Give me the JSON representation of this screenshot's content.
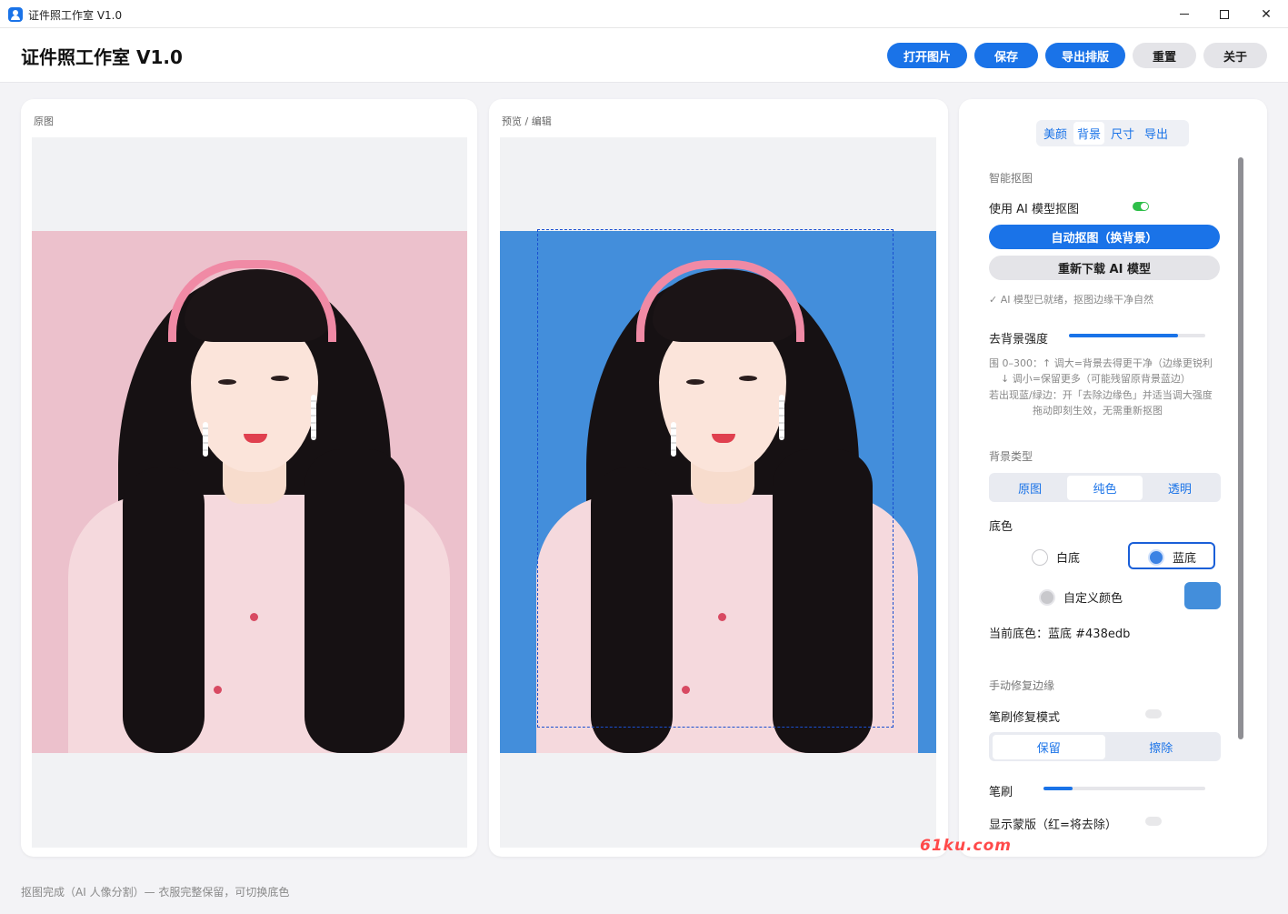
{
  "window": {
    "title": "证件照工作室 V1.0",
    "controls": {
      "minimize": "—",
      "maximize": "☐",
      "close": "✕"
    }
  },
  "header": {
    "title": "证件照工作室 V1.0",
    "buttons": {
      "open": "打开图片",
      "save": "保存",
      "export_layout": "导出排版",
      "reset": "重置",
      "about": "关于"
    }
  },
  "left_panel": {
    "label": "原图"
  },
  "middle_panel": {
    "label": "预览 / 编辑"
  },
  "right_panel": {
    "tabs": [
      "美颜",
      "背景",
      "尺寸",
      "导出"
    ],
    "active_tab": "背景",
    "smart_cutout": {
      "section_title": "智能抠图",
      "use_ai_label": "使用 AI 模型抠图",
      "use_ai_on": true,
      "auto_button": "自动抠图（换背景）",
      "redownload_button": "重新下载 AI 模型",
      "status": "✓ AI 模型已就绪，抠图边缘干净自然"
    },
    "strength": {
      "label": "去背景强度",
      "level_fraction": 0.8,
      "hints": [
        "围 0–300：↑ 调大=背景去得更干净（边缘更锐利",
        "↓ 调小=保留更多（可能残留原背景蓝边）",
        "若出现蓝/绿边：开「去除边缘色」并适当调大强度",
        "拖动即刻生效，无需重新抠图"
      ]
    },
    "background_type": {
      "section_title": "背景类型",
      "options": [
        "原图",
        "纯色",
        "透明"
      ],
      "selected": "纯色"
    },
    "base_color": {
      "label": "底色",
      "white": "白底",
      "blue": "蓝底",
      "custom": "自定义颜色",
      "custom_color": "#438edb",
      "current": "当前底色：蓝底 #438edb"
    },
    "manual_repair": {
      "section_title": "手动修复边缘",
      "brush_mode_label": "笔刷修复模式",
      "brush_mode_on": false,
      "mode_options": [
        "保留",
        "擦除"
      ],
      "mode_selected": "保留",
      "brush_label": "笔刷",
      "brush_fraction": 0.18,
      "mask_label": "显示蒙版（红=将去除）",
      "mask_on": false
    }
  },
  "status_bar": {
    "text": "抠图完成（AI 人像分割）— 衣服完整保留，可切换底色"
  },
  "watermark": {
    "text": "61ku.com"
  },
  "colors": {
    "accent": "#1a73e8",
    "original_bg": "#ecc1cc",
    "preview_bg": "#438edb",
    "toggle_on": "#2fbf4a"
  }
}
